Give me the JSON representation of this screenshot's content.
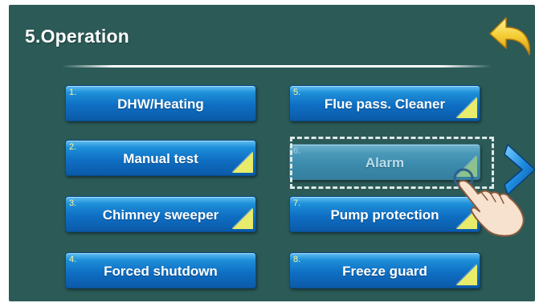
{
  "header": {
    "title": "5.Operation"
  },
  "menu": {
    "items": [
      {
        "num": "1.",
        "label": "DHW/Heating"
      },
      {
        "num": "2.",
        "label": "Manual test"
      },
      {
        "num": "3.",
        "label": "Chimney sweeper"
      },
      {
        "num": "4.",
        "label": "Forced shutdown"
      },
      {
        "num": "5.",
        "label": "Flue pass. Cleaner"
      },
      {
        "num": "6.",
        "label": "Alarm"
      },
      {
        "num": "7.",
        "label": "Pump protection"
      },
      {
        "num": "8.",
        "label": "Freeze guard"
      }
    ]
  },
  "icons": {
    "back": "back-arrow-icon",
    "next": "chevron-right-icon",
    "hand": "pointing-hand-icon"
  },
  "colors": {
    "background": "#2b5a57",
    "button": "#0f6fc4",
    "button_disabled": "#4a99b9",
    "corner": "#e9ec6a",
    "number": "#fff59a",
    "back_arrow": "#f6d13a",
    "next_chevron": "#1e8ce0"
  }
}
